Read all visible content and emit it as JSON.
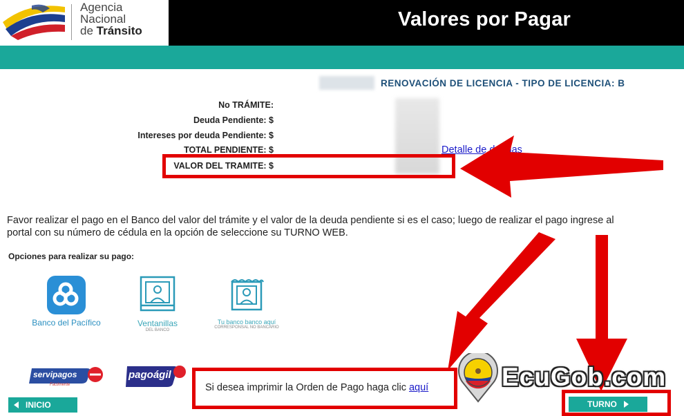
{
  "header": {
    "agency_line1": "Agencia",
    "agency_line2": "Nacional",
    "agency_line3_prefix": "de",
    "agency_line3_bold": "Tránsito",
    "title": "Valores por Pagar"
  },
  "subtitle": "RENOVACIÓN DE LICENCIA - TIPO DE LICENCIA: B",
  "summary": {
    "rows": [
      "No TRÁMITE:",
      "Deuda Pendiente: $",
      "Intereses por deuda Pendiente: $",
      "TOTAL PENDIENTE: $",
      "VALOR DEL TRAMITE: $"
    ],
    "detail_link": "Detalle de deudas"
  },
  "instructions": "Favor realizar el pago en el Banco del valor del trámite y el valor de la deuda pendiente si es el caso; luego de realizar el pago ingrese al portal con su número de cédula en la opción de seleccione su TURNO WEB.",
  "payment": {
    "label": "Opciones para realizar su pago:",
    "options": [
      {
        "name": "Banco del Pacífico",
        "sub": ""
      },
      {
        "name": "Ventanillas",
        "sub": "DEL BANCO"
      },
      {
        "name": "Tu banco banco aquí",
        "sub": "CORRESPONSAL NO BANCARIO"
      }
    ],
    "servipagos": "servipagos",
    "servipagos_sub": "Fácilmente",
    "pagoagil": "pagoágil"
  },
  "print": {
    "text": "Si desea imprimir la Orden de Pago haga clic",
    "link": "aquí"
  },
  "nav": {
    "back": "INICIO",
    "next": "TURNO"
  },
  "watermark": "EcuGob.com",
  "colors": {
    "teal": "#1aa89a",
    "highlight_red": "#e20000",
    "subtitle_blue": "#1d4f78",
    "link_blue": "#1a1ac9"
  }
}
